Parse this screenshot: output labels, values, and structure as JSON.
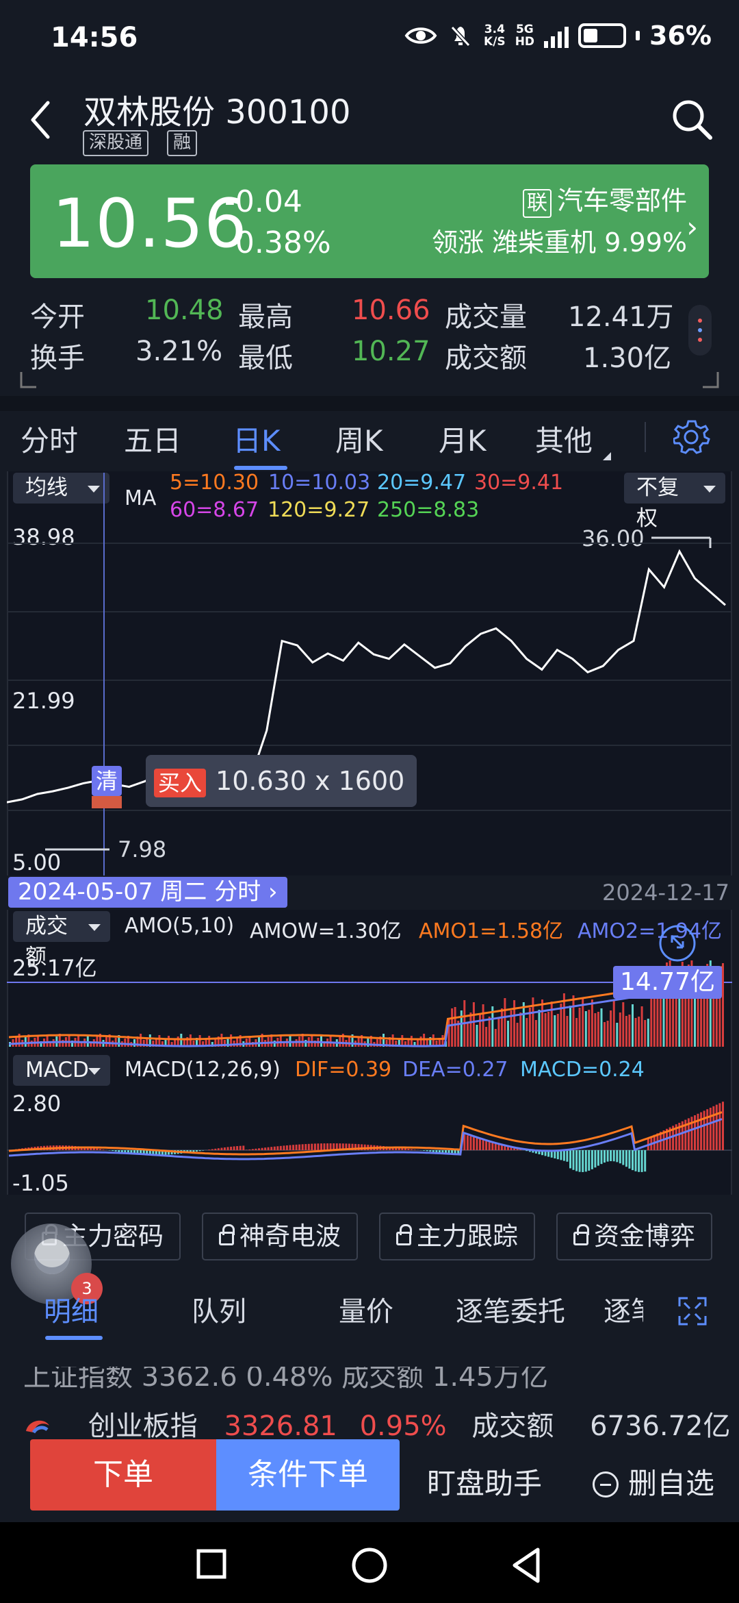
{
  "status": {
    "time": "14:56",
    "net_top": "3.4",
    "net_bottom": "K/S",
    "network_top": "5G",
    "network_bottom": "HD",
    "battery": "36%"
  },
  "stock": {
    "name": "双林股份 300100",
    "tags": [
      "深股通",
      "融"
    ],
    "price": "10.56",
    "change": "-0.04",
    "change_pct": "-0.38%"
  },
  "sector": {
    "badge": "联",
    "name": "汽车零部件",
    "lead_prefix": "领涨",
    "lead_stock": "潍柴重机",
    "lead_pct": "9.99%"
  },
  "stats": {
    "open_label": "今开",
    "open_value": "10.48",
    "high_label": "最高",
    "high_value": "10.66",
    "volume_label": "成交量",
    "volume_value": "12.41万",
    "turnover_label": "换手",
    "turnover_value": "3.21%",
    "low_label": "最低",
    "low_value": "10.27",
    "amount_label": "成交额",
    "amount_value": "1.30亿"
  },
  "period_tabs": [
    "分时",
    "五日",
    "日K",
    "周K",
    "月K",
    "其他"
  ],
  "active_tab": "日K",
  "chart": {
    "ma_selector": "均线",
    "ma_label": "MA",
    "ma_values": [
      "5=10.30",
      "10=10.03",
      "20=9.47",
      "30=9.41",
      "60=8.67",
      "120=9.27",
      "250=8.83"
    ],
    "ma_colors": [
      "#ff7a20",
      "#697ef6",
      "#5cc8ff",
      "#ef4d4d",
      "#d646e8",
      "#f0dc57",
      "#55d455"
    ],
    "adjust": "不复权",
    "y_top": "38.98",
    "y_mid": "21.99",
    "y_bottom": "5.00",
    "high_mark": "36.00",
    "low_mark": "7.98",
    "crosshair_date": "2024-05-07 周二 分时",
    "end_date": "2024-12-17",
    "tooltip_action": "买入",
    "tooltip_text": "10.630 x 1600",
    "clear_badge": "清"
  },
  "amount": {
    "selector": "成交额",
    "label": "AMO(5,10)",
    "amow": "AMOW=1.30亿",
    "amo1": "AMO1=1.58亿",
    "amo2": "AMO2=1.94亿",
    "axis_top": "25.17亿",
    "marker_value": "14.77亿"
  },
  "macd": {
    "selector": "MACD",
    "label": "MACD(12,26,9)",
    "dif": "DIF=0.39",
    "dea": "DEA=0.27",
    "macd": "MACD=0.24",
    "axis_top": "2.80",
    "axis_bottom": "-1.05"
  },
  "feature_buttons": [
    "主力密码",
    "神奇电波",
    "主力跟踪",
    "资金博弈"
  ],
  "avatar_badge": "3",
  "detail_tabs": [
    "明细",
    "队列",
    "量价",
    "逐笔委托",
    "逐笔"
  ],
  "ticker": {
    "row1": "上证指数  3362.6  0.48%  成交额  1.45万亿",
    "index_name": "创业板指",
    "index_value": "3326.81",
    "index_pct": "0.95%",
    "amount_label": "成交额",
    "amount_value": "6736.72亿"
  },
  "bottom_actions": {
    "order": "下单",
    "conditional": "条件下单",
    "watch": "盯盘助手",
    "remove": "删自选"
  },
  "chart_data": [
    {
      "type": "line",
      "title": "",
      "x": [
        "2024-05-07",
        "2024-12-17"
      ],
      "y_axis_ticks": [
        "38.98",
        "21.99",
        "5.00"
      ],
      "series": [
        {
          "name": "",
          "values": [
            7.98,
            8.3,
            8.9,
            9.2,
            9.6,
            10.1,
            10.4,
            10.0,
            9.7,
            10.3,
            11.1,
            10.5,
            10.3,
            10.0,
            10.5,
            11.0,
            10.9,
            16.0,
            26.0,
            25.5,
            23.6,
            24.6,
            23.8,
            25.8,
            24.5,
            24.0,
            25.6,
            24.3,
            23.0,
            23.5,
            25.4,
            26.8,
            27.4,
            26.0,
            24.0,
            22.8,
            25.0,
            24.0,
            22.5,
            23.2,
            25.0,
            26.0,
            34.0,
            32.0,
            36.0,
            33.0,
            31.5,
            30.0
          ]
        }
      ],
      "annotations": [
        "36.00",
        "7.98"
      ]
    }
  ]
}
